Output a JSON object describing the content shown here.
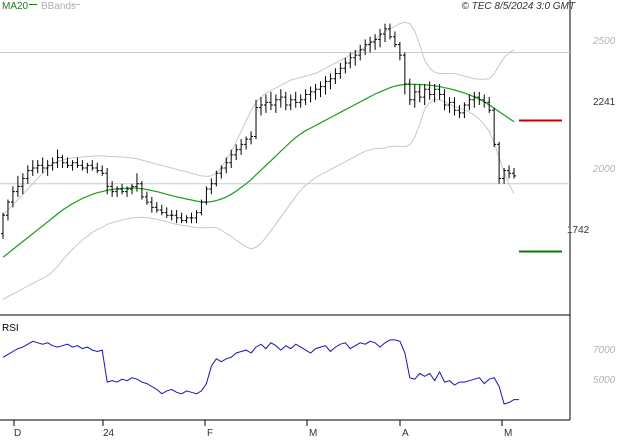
{
  "header": {
    "ma_legend": "MA20",
    "bbands_legend": "BBands",
    "source": "© TEC 8/5/2024 3:0 GMT"
  },
  "chart_data": [
    {
      "type": "candlestick",
      "series": [
        {
          "name": "Price",
          "ohlc": [
            [
              1810,
              1890,
              1790,
              1880
            ],
            [
              1880,
              1940,
              1860,
              1930
            ],
            [
              1930,
              1990,
              1910,
              1970
            ],
            [
              1970,
              2030,
              1950,
              1990
            ],
            [
              1990,
              2040,
              1960,
              2020
            ],
            [
              2020,
              2070,
              2000,
              2050
            ],
            [
              2050,
              2090,
              2030,
              2060
            ],
            [
              2060,
              2090,
              2040,
              2070
            ],
            [
              2070,
              2100,
              2040,
              2060
            ],
            [
              2060,
              2090,
              2030,
              2070
            ],
            [
              2070,
              2100,
              2050,
              2080
            ],
            [
              2080,
              2130,
              2060,
              2100
            ],
            [
              2100,
              2110,
              2060,
              2080
            ],
            [
              2080,
              2100,
              2060,
              2070
            ],
            [
              2070,
              2090,
              2050,
              2080
            ],
            [
              2080,
              2100,
              2060,
              2070
            ],
            [
              2070,
              2090,
              2050,
              2060
            ],
            [
              2060,
              2080,
              2040,
              2070
            ],
            [
              2070,
              2090,
              2050,
              2060
            ],
            [
              2060,
              2080,
              2040,
              2050
            ],
            [
              2050,
              2070,
              2030,
              2040
            ],
            [
              2040,
              2060,
              1960,
              1990
            ],
            [
              1990,
              2010,
              1950,
              1970
            ],
            [
              1970,
              1990,
              1950,
              1980
            ],
            [
              1980,
              2000,
              1960,
              1970
            ],
            [
              1970,
              1990,
              1950,
              1980
            ],
            [
              1980,
              2000,
              1960,
              1990
            ],
            [
              1990,
              2040,
              1970,
              2000
            ],
            [
              2000,
              2010,
              1940,
              1950
            ],
            [
              1950,
              1970,
              1920,
              1930
            ],
            [
              1930,
              1950,
              1890,
              1910
            ],
            [
              1910,
              1930,
              1890,
              1900
            ],
            [
              1900,
              1920,
              1880,
              1890
            ],
            [
              1890,
              1910,
              1870,
              1880
            ],
            [
              1880,
              1900,
              1860,
              1880
            ],
            [
              1880,
              1900,
              1850,
              1870
            ],
            [
              1870,
              1890,
              1850,
              1860
            ],
            [
              1860,
              1880,
              1850,
              1870
            ],
            [
              1870,
              1890,
              1850,
              1870
            ],
            [
              1870,
              1900,
              1850,
              1890
            ],
            [
              1890,
              1940,
              1880,
              1930
            ],
            [
              1930,
              1990,
              1920,
              1980
            ],
            [
              1980,
              2020,
              1960,
              2000
            ],
            [
              2000,
              2050,
              1990,
              2040
            ],
            [
              2040,
              2070,
              2020,
              2060
            ],
            [
              2060,
              2100,
              2040,
              2080
            ],
            [
              2080,
              2130,
              2060,
              2110
            ],
            [
              2110,
              2150,
              2090,
              2130
            ],
            [
              2130,
              2170,
              2110,
              2150
            ],
            [
              2150,
              2180,
              2130,
              2170
            ],
            [
              2170,
              2200,
              2150,
              2180
            ],
            [
              2180,
              2320,
              2170,
              2290
            ],
            [
              2290,
              2330,
              2260,
              2300
            ],
            [
              2300,
              2340,
              2270,
              2310
            ],
            [
              2310,
              2350,
              2280,
              2300
            ],
            [
              2300,
              2340,
              2270,
              2320
            ],
            [
              2320,
              2360,
              2290,
              2330
            ],
            [
              2330,
              2350,
              2280,
              2300
            ],
            [
              2300,
              2340,
              2280,
              2320
            ],
            [
              2320,
              2350,
              2290,
              2310
            ],
            [
              2310,
              2340,
              2290,
              2320
            ],
            [
              2320,
              2360,
              2300,
              2340
            ],
            [
              2340,
              2370,
              2310,
              2350
            ],
            [
              2350,
              2380,
              2320,
              2360
            ],
            [
              2360,
              2390,
              2330,
              2370
            ],
            [
              2370,
              2410,
              2340,
              2390
            ],
            [
              2390,
              2420,
              2360,
              2400
            ],
            [
              2400,
              2440,
              2380,
              2420
            ],
            [
              2420,
              2460,
              2400,
              2440
            ],
            [
              2440,
              2480,
              2420,
              2460
            ],
            [
              2460,
              2500,
              2440,
              2480
            ],
            [
              2480,
              2510,
              2450,
              2490
            ],
            [
              2490,
              2530,
              2470,
              2510
            ],
            [
              2510,
              2550,
              2490,
              2530
            ],
            [
              2530,
              2560,
              2500,
              2540
            ],
            [
              2540,
              2570,
              2510,
              2550
            ],
            [
              2550,
              2590,
              2520,
              2570
            ],
            [
              2570,
              2610,
              2540,
              2590
            ],
            [
              2590,
              2610,
              2550,
              2560
            ],
            [
              2560,
              2580,
              2520,
              2530
            ],
            [
              2530,
              2540,
              2470,
              2490
            ],
            [
              2490,
              2500,
              2340,
              2380
            ],
            [
              2380,
              2400,
              2300,
              2320
            ],
            [
              2320,
              2380,
              2290,
              2350
            ],
            [
              2350,
              2380,
              2310,
              2330
            ],
            [
              2330,
              2380,
              2300,
              2360
            ],
            [
              2360,
              2390,
              2320,
              2340
            ],
            [
              2340,
              2380,
              2310,
              2360
            ],
            [
              2360,
              2380,
              2320,
              2340
            ],
            [
              2340,
              2360,
              2280,
              2300
            ],
            [
              2300,
              2330,
              2270,
              2310
            ],
            [
              2310,
              2330,
              2260,
              2280
            ],
            [
              2280,
              2300,
              2250,
              2270
            ],
            [
              2270,
              2310,
              2250,
              2300
            ],
            [
              2300,
              2340,
              2280,
              2320
            ],
            [
              2320,
              2350,
              2290,
              2330
            ],
            [
              2330,
              2350,
              2300,
              2320
            ],
            [
              2320,
              2340,
              2290,
              2310
            ],
            [
              2310,
              2330,
              2270,
              2280
            ],
            [
              2280,
              2290,
              2140,
              2150
            ],
            [
              2150,
              2160,
              2000,
              2020
            ],
            [
              2020,
              2060,
              2000,
              2050
            ],
            [
              2050,
              2070,
              2020,
              2040
            ],
            [
              2040,
              2060,
              2020,
              2030
            ]
          ]
        },
        {
          "name": "MA20",
          "values": [
            1720,
            1735,
            1750,
            1765,
            1780,
            1795,
            1810,
            1825,
            1840,
            1855,
            1870,
            1885,
            1900,
            1912,
            1924,
            1934,
            1944,
            1952,
            1960,
            1966,
            1970,
            1975,
            1978,
            1980,
            1982,
            1983,
            1984,
            1983,
            1981,
            1978,
            1974,
            1970,
            1965,
            1960,
            1955,
            1950,
            1946,
            1942,
            1938,
            1934,
            1931,
            1930,
            1932,
            1936,
            1942,
            1950,
            1960,
            1972,
            1986,
            2000,
            2016,
            2034,
            2052,
            2070,
            2088,
            2106,
            2124,
            2142,
            2160,
            2176,
            2190,
            2202,
            2212,
            2222,
            2232,
            2242,
            2252,
            2262,
            2272,
            2282,
            2292,
            2302,
            2312,
            2322,
            2332,
            2342,
            2350,
            2358,
            2366,
            2372,
            2376,
            2378,
            2379,
            2379,
            2378,
            2377,
            2375,
            2373,
            2370,
            2366,
            2362,
            2357,
            2352,
            2346,
            2339,
            2331,
            2322,
            2312,
            2300,
            2288,
            2275,
            2262,
            2249,
            2236
          ]
        },
        {
          "name": "BBands upper",
          "values": [
            1880,
            1900,
            1920,
            1940,
            1960,
            1980,
            2000,
            2020,
            2040,
            2060,
            2075,
            2085,
            2090,
            2095,
            2098,
            2100,
            2102,
            2104,
            2105,
            2106,
            2106,
            2105,
            2104,
            2103,
            2102,
            2100,
            2098,
            2095,
            2090,
            2085,
            2080,
            2075,
            2070,
            2065,
            2060,
            2055,
            2050,
            2045,
            2040,
            2035,
            2030,
            2028,
            2030,
            2040,
            2060,
            2090,
            2120,
            2160,
            2200,
            2240,
            2280,
            2310,
            2330,
            2345,
            2355,
            2365,
            2375,
            2385,
            2395,
            2400,
            2405,
            2410,
            2415,
            2420,
            2430,
            2440,
            2450,
            2460,
            2470,
            2480,
            2490,
            2500,
            2510,
            2520,
            2535,
            2550,
            2565,
            2580,
            2590,
            2600,
            2610,
            2615,
            2610,
            2580,
            2530,
            2470,
            2440,
            2425,
            2420,
            2420,
            2420,
            2420,
            2415,
            2410,
            2405,
            2400,
            2398,
            2398,
            2400,
            2420,
            2450,
            2480,
            2500,
            2510
          ]
        },
        {
          "name": "BBands lower",
          "values": [
            1560,
            1570,
            1580,
            1590,
            1600,
            1610,
            1620,
            1630,
            1640,
            1650,
            1665,
            1685,
            1710,
            1730,
            1750,
            1768,
            1786,
            1800,
            1815,
            1826,
            1834,
            1845,
            1852,
            1857,
            1862,
            1866,
            1870,
            1871,
            1872,
            1871,
            1868,
            1865,
            1860,
            1855,
            1850,
            1845,
            1842,
            1839,
            1836,
            1833,
            1832,
            1832,
            1834,
            1832,
            1824,
            1810,
            1800,
            1784,
            1772,
            1760,
            1752,
            1758,
            1774,
            1795,
            1821,
            1847,
            1873,
            1899,
            1925,
            1952,
            1975,
            1994,
            2009,
            2024,
            2034,
            2044,
            2054,
            2064,
            2074,
            2084,
            2094,
            2104,
            2114,
            2124,
            2129,
            2134,
            2135,
            2136,
            2142,
            2144,
            2142,
            2141,
            2148,
            2178,
            2226,
            2284,
            2310,
            2321,
            2320,
            2312,
            2304,
            2294,
            2289,
            2282,
            2273,
            2262,
            2246,
            2226,
            2200,
            2156,
            2100,
            2044,
            1998,
            1962
          ]
        }
      ],
      "x_tick_labels": [
        "D",
        "24",
        "F",
        "M",
        "A",
        "M"
      ],
      "y_tick_labels": [
        "2500",
        "2000"
      ],
      "ylim": [
        1500,
        2700
      ],
      "annotations": [
        {
          "label": "2241",
          "value": 2241,
          "color": "#cc0000"
        },
        {
          "label": "1742",
          "value": 1742,
          "color": "#008000"
        }
      ],
      "reference_lines": [
        2500,
        2000
      ],
      "grid": false
    },
    {
      "type": "line",
      "title": "RSI",
      "series": [
        {
          "name": "RSI",
          "values": [
            63,
            65,
            67,
            69,
            70,
            72,
            74,
            73,
            72,
            73,
            71,
            70,
            71,
            72,
            70,
            71,
            69,
            70,
            68,
            67,
            68,
            46,
            47,
            46,
            48,
            47,
            49,
            48,
            46,
            45,
            43,
            41,
            38,
            40,
            41,
            39,
            38,
            40,
            39,
            38,
            40,
            45,
            57,
            62,
            60,
            62,
            63,
            66,
            67,
            68,
            66,
            70,
            72,
            69,
            73,
            71,
            68,
            71,
            69,
            72,
            70,
            68,
            66,
            69,
            70,
            71,
            67,
            70,
            72,
            73,
            69,
            71,
            73,
            72,
            74,
            73,
            70,
            73,
            75,
            75,
            74,
            66,
            49,
            48,
            52,
            50,
            52,
            47,
            53,
            46,
            47,
            44,
            46,
            46,
            47,
            48,
            49,
            45,
            48,
            49,
            43,
            31,
            32,
            34,
            34
          ]
        }
      ],
      "y_tick_labels": [
        "7000",
        "5000"
      ],
      "ylim": [
        20,
        90
      ],
      "grid": false
    }
  ]
}
